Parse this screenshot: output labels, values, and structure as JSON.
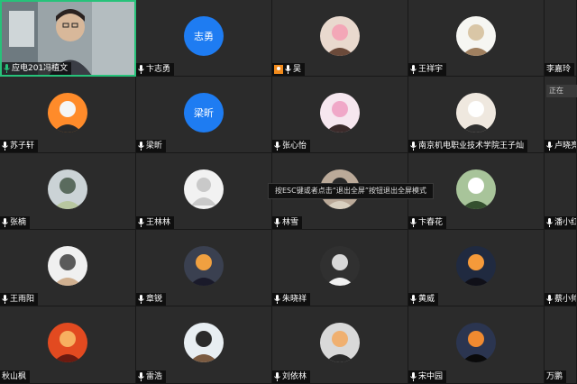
{
  "meeting": {
    "tooltip": "按ESC键或者点击“退出全屏”按钮退出全屏模式",
    "side_badge": "正在",
    "colors": {
      "tile_bg": "#2b2b2b",
      "avatar_text_bg": "#1e7cf2",
      "active_border": "#27c27a",
      "host_badge": "#f28b1c"
    },
    "participants": [
      {
        "name": "应电201冯植文",
        "avatar": "video",
        "mic": "on",
        "active": true
      },
      {
        "name": "卞志勇",
        "avatar": "text",
        "avatar_text": "志勇",
        "mic": "off"
      },
      {
        "name": "吴",
        "avatar": "photo",
        "mic": "off",
        "host": true
      },
      {
        "name": "王祥宇",
        "avatar": "photo",
        "mic": "off"
      },
      {
        "name": "李嘉玲",
        "avatar": "none",
        "mic": "none"
      },
      {
        "name": "苏子轩",
        "avatar": "photo",
        "mic": "off"
      },
      {
        "name": "梁昕",
        "avatar": "text",
        "avatar_text": "梁昕",
        "mic": "off"
      },
      {
        "name": "张心怡",
        "avatar": "photo",
        "mic": "off"
      },
      {
        "name": "南京机电职业技术学院王子灿",
        "avatar": "photo",
        "mic": "off"
      },
      {
        "name": "卢晓亮",
        "avatar": "none",
        "mic": "off"
      },
      {
        "name": "张楠",
        "avatar": "photo",
        "mic": "off"
      },
      {
        "name": "王林林",
        "avatar": "default",
        "mic": "off"
      },
      {
        "name": "林雪",
        "avatar": "photo",
        "mic": "off"
      },
      {
        "name": "卞春花",
        "avatar": "photo",
        "mic": "off"
      },
      {
        "name": "潘小红",
        "avatar": "none",
        "mic": "off"
      },
      {
        "name": "王雨阳",
        "avatar": "photo",
        "mic": "off"
      },
      {
        "name": "章锐",
        "avatar": "photo",
        "mic": "off"
      },
      {
        "name": "朱晓祥",
        "avatar": "photo",
        "mic": "off"
      },
      {
        "name": "黄威",
        "avatar": "photo",
        "mic": "off"
      },
      {
        "name": "蔡小帅",
        "avatar": "none",
        "mic": "off"
      },
      {
        "name": "秋山枫",
        "avatar": "photo",
        "mic": "none"
      },
      {
        "name": "雷浩",
        "avatar": "photo",
        "mic": "off"
      },
      {
        "name": "刘依林",
        "avatar": "photo",
        "mic": "off"
      },
      {
        "name": "宋中园",
        "avatar": "photo",
        "mic": "off"
      },
      {
        "name": "万鹏",
        "avatar": "none",
        "mic": "none"
      }
    ]
  }
}
